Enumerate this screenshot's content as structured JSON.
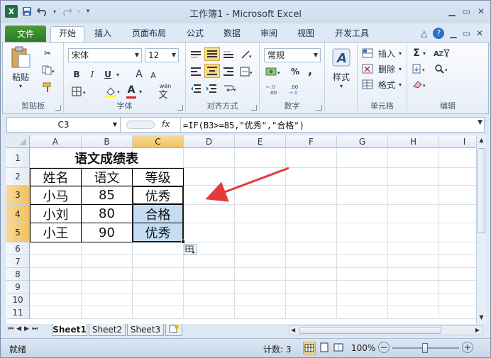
{
  "window": {
    "title": "工作簿1 - Microsoft Excel"
  },
  "qat": {
    "save": "save-icon",
    "undo": "undo-icon",
    "redo": "redo-icon"
  },
  "tabs": {
    "file": "文件",
    "home": "开始",
    "insert": "插入",
    "layout": "页面布局",
    "formulas": "公式",
    "data": "数据",
    "review": "审阅",
    "view": "视图",
    "developer": "开发工具"
  },
  "ribbon": {
    "clipboard": {
      "paste": "粘贴",
      "label": "剪贴板"
    },
    "font": {
      "name": "宋体",
      "size": "12",
      "bold": "B",
      "italic": "I",
      "underline": "U",
      "grow": "A",
      "shrink": "A",
      "color_a": "A",
      "wen": "wén",
      "wen2": "文",
      "label": "字体"
    },
    "align": {
      "label": "对齐方式"
    },
    "number": {
      "format": "常规",
      "percent": "%",
      "comma": ",",
      "label": "数字"
    },
    "styles": {
      "label": "样式"
    },
    "cells": {
      "insert": "插入",
      "delete": "删除",
      "format": "格式",
      "label": "单元格"
    },
    "edit": {
      "sum": "Σ",
      "label": "编辑"
    }
  },
  "formula_bar": {
    "name_box": "C3",
    "fx": "fx",
    "formula": "=IF(B3>=85,\"优秀\",\"合格\")"
  },
  "columns": [
    "A",
    "B",
    "C",
    "D",
    "E",
    "F",
    "G",
    "H",
    "I"
  ],
  "rows": [
    "1",
    "2",
    "3",
    "4",
    "5",
    "6",
    "7",
    "8",
    "9",
    "10",
    "11"
  ],
  "sheet": {
    "title": "语文成绩表",
    "headers": [
      "姓名",
      "语文",
      "等级"
    ],
    "data": [
      {
        "name": "小马",
        "score": "85",
        "grade": "优秀"
      },
      {
        "name": "小刘",
        "score": "80",
        "grade": "合格"
      },
      {
        "name": "小王",
        "score": "90",
        "grade": "优秀"
      }
    ]
  },
  "sheet_tabs": [
    "Sheet1",
    "Sheet2",
    "Sheet3"
  ],
  "status": {
    "mode": "就绪",
    "count": "计数: 3",
    "zoom": "100%"
  },
  "colors": {
    "selected_fill": "#c5dcf5",
    "arrow": "#e23b3b",
    "file_tab": "#3f8f30"
  }
}
